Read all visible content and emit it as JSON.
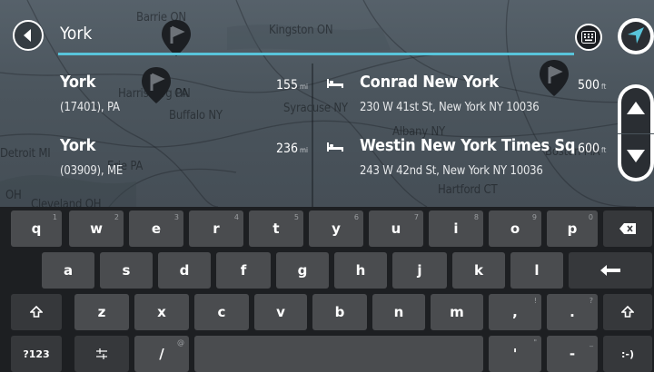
{
  "search": {
    "value": "York"
  },
  "map_labels": [
    "Barrie ON",
    "Kingston ON",
    "Harrisburg PA",
    "ON",
    "Buffalo NY",
    "Syracuse NY",
    "Albany NY",
    "Boston MA",
    "Detroit MI",
    "Erie PA",
    "Hartford CT",
    "OH",
    "Cleveland OH"
  ],
  "results_left": [
    {
      "name": "York",
      "sub": "(17401), PA",
      "dist": "155",
      "unit": "mi"
    },
    {
      "name": "York",
      "sub": "(03909), ME",
      "dist": "236",
      "unit": "mi"
    }
  ],
  "results_right": [
    {
      "name": "Conrad New York",
      "sub": "230 W 41st St, New York NY 10036",
      "dist": "500",
      "unit": "ft",
      "icon": "hotel-icon"
    },
    {
      "name": "Westin New York Times Sq",
      "sub": "243 W 42nd St, New York NY 10036",
      "dist": "600",
      "unit": "ft",
      "icon": "hotel-icon"
    }
  ],
  "keyboard": {
    "row1": [
      {
        "k": "q",
        "h": "1"
      },
      {
        "k": "w",
        "h": "2"
      },
      {
        "k": "e",
        "h": "3"
      },
      {
        "k": "r",
        "h": "4"
      },
      {
        "k": "t",
        "h": "5"
      },
      {
        "k": "y",
        "h": "6"
      },
      {
        "k": "u",
        "h": "7"
      },
      {
        "k": "i",
        "h": "8"
      },
      {
        "k": "o",
        "h": "9"
      },
      {
        "k": "p",
        "h": "0"
      }
    ],
    "row2": [
      "a",
      "s",
      "d",
      "f",
      "g",
      "h",
      "j",
      "k",
      "l"
    ],
    "row3": [
      "z",
      "x",
      "c",
      "v",
      "b",
      "n",
      "m",
      ",",
      "."
    ],
    "row3_hints": [
      "",
      "",
      "",
      "",
      "",
      "",
      "",
      "!",
      "?"
    ],
    "sym_label": "?123",
    "slash": "/",
    "slash_hint": "@",
    "quote": "'",
    "quote_hint": "\"",
    "dash": "-",
    "dash_hint": "_",
    "smiley": ":-)"
  },
  "colors": {
    "accent": "#58c4da",
    "key": "#4a4c4f",
    "keyboard_bg": "#1d1f22"
  }
}
